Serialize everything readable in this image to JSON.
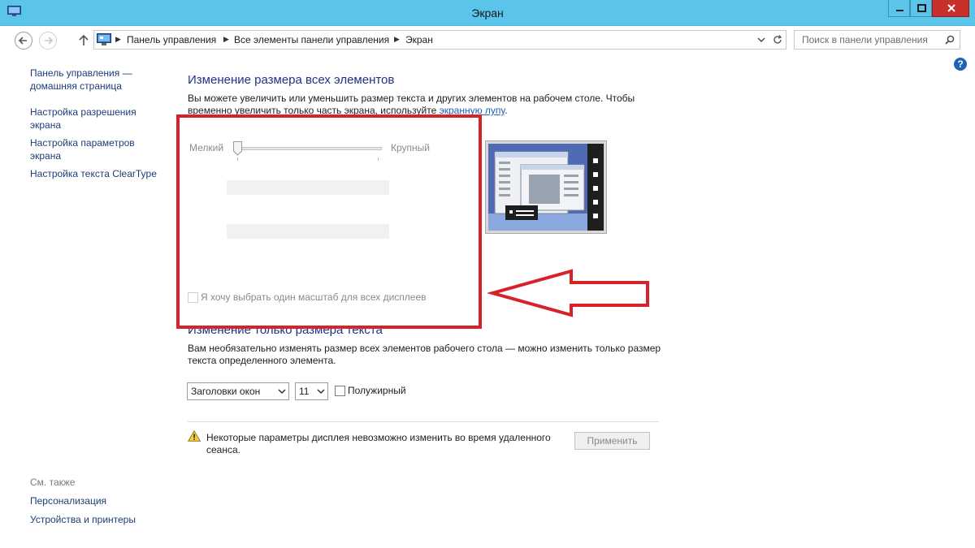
{
  "window": {
    "title": "Экран",
    "app_icon": "display-settings-icon"
  },
  "nav": {
    "back_icon": "back-arrow-icon",
    "forward_icon": "forward-arrow-icon",
    "up_icon": "up-arrow-icon",
    "breadcrumbs": [
      "Панель управления",
      "Все элементы панели управления",
      "Экран"
    ],
    "search_placeholder": "Поиск в панели управления"
  },
  "help": {
    "label": "?"
  },
  "sidebar": {
    "links": [
      "Панель управления —\nдомашняя страница",
      "Настройка разрешения\nэкрана",
      "Настройка параметров\nэкрана",
      "Настройка текста ClearType"
    ],
    "see_also_label": "См. также",
    "see_also": [
      "Персонализация",
      "Устройства и принтеры"
    ]
  },
  "resize_all": {
    "title": "Изменение размера всех элементов",
    "desc_before": "Вы можете увеличить или уменьшить размер текста и других элементов на рабочем столе. Чтобы временно увеличить только часть экрана, используйте ",
    "link": "экранную лупу",
    "desc_after": ".",
    "slider_min_label": "Мелкий",
    "slider_max_label": "Крупный",
    "slider_value_fraction": 0,
    "single_scale_checkbox": {
      "label": "Я хочу выбрать один масштаб для всех дисплеев",
      "checked": false
    }
  },
  "resize_text": {
    "title": "Изменение только размера текста",
    "desc": "Вам необязательно изменять размер всех элементов рабочего стола — можно изменить только размер текста определенного элемента.",
    "element_select": "Заголовки окон",
    "size_select": "11",
    "bold_checkbox": {
      "label": "Полужирный",
      "checked": false
    }
  },
  "warning": {
    "text": "Некоторые параметры дисплея невозможно изменить во время удаленного сеанса.",
    "apply_button": "Применить"
  },
  "colors": {
    "titlebar": "#5ac4ea",
    "close_button": "#c7302b",
    "section_title": "#1e3287",
    "highlight_frame": "#d8222a"
  }
}
